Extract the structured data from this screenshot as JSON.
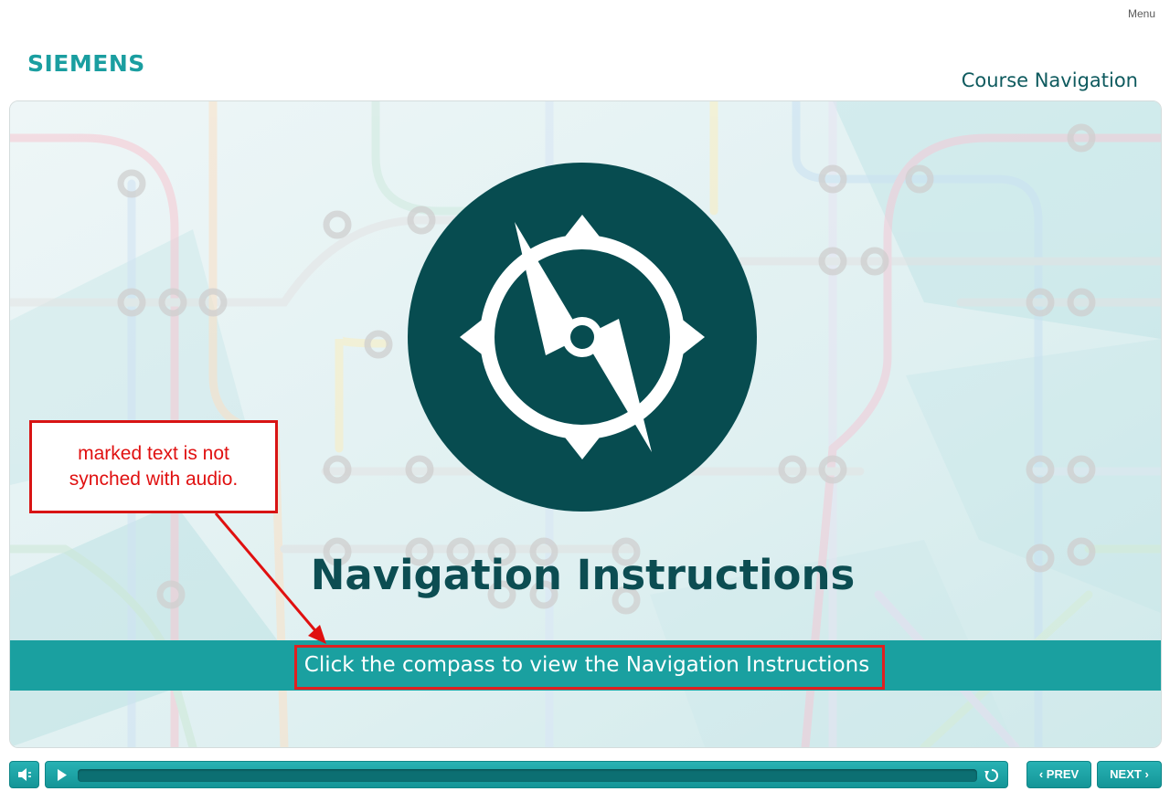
{
  "header": {
    "menu_label": "Menu",
    "logo_text": "SIEMENS",
    "course_title": "Course Navigation"
  },
  "slide": {
    "compass_icon": "compass-icon",
    "title": "Navigation Instructions",
    "instruction": "Click the compass to view the Navigation Instructions"
  },
  "annotation": {
    "callout_text": "marked text is not synched with audio.",
    "color": "#e01010"
  },
  "player": {
    "volume_icon": "volume-icon",
    "play_icon": "play-icon",
    "replay_icon": "replay-icon",
    "progress": 0,
    "prev_label": "PREV",
    "next_label": "NEXT"
  },
  "colors": {
    "brand": "#1a9ea0",
    "dark_teal": "#074c50",
    "band": "#1aa0a0"
  }
}
